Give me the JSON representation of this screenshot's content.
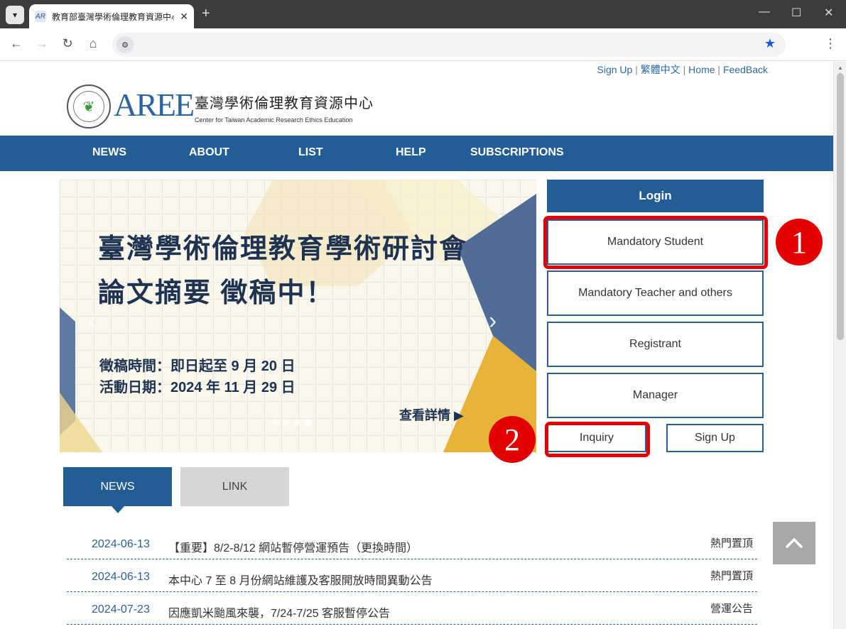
{
  "browser": {
    "tab_title": "教育部臺灣學術倫理教育資源中心",
    "tab_favicon": "AR",
    "address": "",
    "icons": {
      "tab_menu": "chevron-down-icon",
      "close_tab": "close-icon",
      "new_tab": "plus-icon",
      "back": "back-arrow-icon",
      "forward": "forward-arrow-icon",
      "reload": "reload-icon",
      "home": "home-icon",
      "bookmark": "star-icon",
      "menu": "kebab-menu-icon"
    }
  },
  "toplinks": {
    "signup": "Sign Up",
    "traditional": "繁體中文",
    "home": "Home",
    "feedback": "FeedBack",
    "separator": "|"
  },
  "logo": {
    "mark": "AREE",
    "name_cn": "臺灣學術倫理教育資源中心",
    "name_en": "Center for Taiwan Academic Research Ethics Education"
  },
  "nav": {
    "news": "NEWS",
    "about": "ABOUT",
    "list": "LIST",
    "help": "HELP",
    "subscriptions": "SUBSCRIPTIONS"
  },
  "banner": {
    "headline1": "臺灣學術倫理教育學術研討會",
    "headline2": "論文摘要 徵稿中！",
    "detail1": "徵稿時間：即日起至 9 月 20 日",
    "detail2": "活動日期：2024 年 11 月 29 日",
    "more": "查看詳情 ▶",
    "prev": "‹",
    "next": "›"
  },
  "login": {
    "title": "Login",
    "mandatory_student": "Mandatory Student",
    "mandatory_teacher": "Mandatory Teacher and others",
    "registrant": "Registrant",
    "manager": "Manager",
    "inquiry": "Inquiry",
    "signup": "Sign Up"
  },
  "callouts": {
    "one": "1",
    "two": "2"
  },
  "tabs": {
    "news": "NEWS",
    "link": "LINK"
  },
  "news": [
    {
      "date": "2024-06-13",
      "title": "【重要】8/2-8/12 網站暫停營運預告（更換時間）",
      "category": "熱門置頂"
    },
    {
      "date": "2024-06-13",
      "title": "本中心 7 至 8 月份網站維護及客服開放時間異動公告",
      "category": "熱門置頂"
    },
    {
      "date": "2024-07-23",
      "title": "因應凱米颱風來襲，7/24-7/25 客服暫停公告",
      "category": "營運公告"
    }
  ],
  "colors": {
    "brand": "#235d95",
    "highlight": "#e30000",
    "link": "#2b69a8"
  }
}
